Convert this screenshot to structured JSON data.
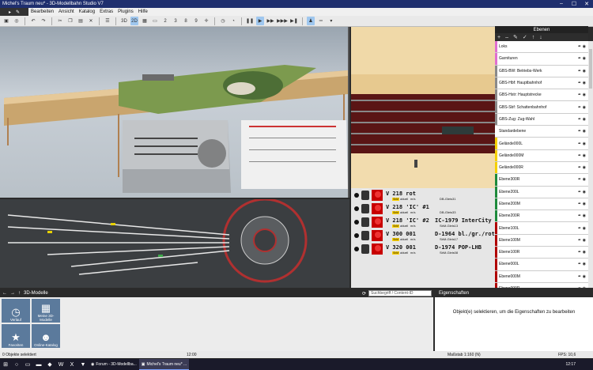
{
  "window": {
    "title": "Michel's Traum neu* - 3D-Modellbahn Studio V7",
    "min": "–",
    "max": "☐",
    "close": "✕"
  },
  "menu": [
    "Bearbeiten",
    "Ansicht",
    "Katalog",
    "Extras",
    "Plugins",
    "Hilfe"
  ],
  "toolbar": {
    "view3d": "3D",
    "view2d": "2D",
    "nums": [
      "2",
      "3",
      "8",
      "9"
    ]
  },
  "layers": {
    "title": "Ebenen",
    "items": [
      {
        "name": "Loks",
        "color": "#e06fd0"
      },
      {
        "name": "Garnituren",
        "color": "#e06fd0"
      },
      {
        "name": "GBS-BW: Betriebs-Werk",
        "color": "#8a8a8a"
      },
      {
        "name": "GBS-Hbf: Hauptbahnhof",
        "color": "#8a8a8a"
      },
      {
        "name": "GBS-Hstr: Hauptstrecke",
        "color": "#8a8a8a"
      },
      {
        "name": "GBS-Sbf: Schattenbahnhof",
        "color": "#8a8a8a"
      },
      {
        "name": "GBS-Zug: Zug-Wahl",
        "color": "#8a8a8a"
      },
      {
        "name": "Standardebene",
        "color": "#ffffff"
      },
      {
        "name": "Gelände000L",
        "color": "#f5d000"
      },
      {
        "name": "Gelände000M",
        "color": "#f5d000"
      },
      {
        "name": "Gelände000R",
        "color": "#f5d000"
      },
      {
        "name": "Ebene300R",
        "color": "#1e8a3c"
      },
      {
        "name": "Ebene200L",
        "color": "#1e8a3c"
      },
      {
        "name": "Ebene200M",
        "color": "#1e8a3c"
      },
      {
        "name": "Ebene200R",
        "color": "#1e8a3c"
      },
      {
        "name": "Ebene100L",
        "color": "#b00000"
      },
      {
        "name": "Ebene100M",
        "color": "#b00000"
      },
      {
        "name": "Ebene100R",
        "color": "#b00000"
      },
      {
        "name": "Ebene000L",
        "color": "#b00000"
      },
      {
        "name": "Ebene000M",
        "color": "#b00000"
      },
      {
        "name": "Ebene000R",
        "color": "#b00000"
      }
    ]
  },
  "trains": [
    {
      "name": "V 218 rot",
      "tag": "SbM",
      "status": "aktuell",
      "unit": "m/s",
      "track": "DB-Gleis31",
      "name2": ""
    },
    {
      "name": "V 218 'IC' #1",
      "tag": "SbM",
      "status": "aktuell",
      "unit": "m/s",
      "track": "DB-Gleis33",
      "name2": ""
    },
    {
      "name": "V 218 'IC' #2",
      "tag": "SbM",
      "status": "aktuell",
      "unit": "m/s",
      "track": "SbM-Gleis13",
      "name2": "IC-1979 InterCity"
    },
    {
      "name": "V 300 001",
      "tag": "SbM",
      "status": "aktuell",
      "unit": "m/s",
      "track": "SbM-Gleis17",
      "name2": "D-1964 bl./gr./rot"
    },
    {
      "name": "V 320 001",
      "tag": "SbM",
      "status": "aktuell",
      "unit": "m/s",
      "track": "SbM-Gleis08",
      "name2": "D-1974 POP-LHB"
    }
  ],
  "models": {
    "title": "3D-Modelle",
    "search_placeholder": "Suchbegriff / Content-ID",
    "tiles": [
      {
        "label": "Verlauf",
        "icon": "clock-icon"
      },
      {
        "label": "Meine 3D-Modelle",
        "icon": "grid-icon"
      },
      {
        "label": "Favoriten",
        "icon": "star-icon"
      },
      {
        "label": "Online-Katalog",
        "icon": "people-icon"
      }
    ]
  },
  "properties": {
    "title": "Eigenschaften",
    "hint": "Objekt(e) selektieren, um die Eigenschaften zu bearbeiten"
  },
  "status": {
    "selected": "0 Objekte selektiert",
    "time": "12:00",
    "scale": "Maßstab 1:160 (N)",
    "fps": "FPS: 10,6"
  },
  "taskbar": {
    "items": [
      "Forum - 3D-Modellba...",
      "Michel's Traum neu* ..."
    ],
    "clock": "12:17"
  }
}
